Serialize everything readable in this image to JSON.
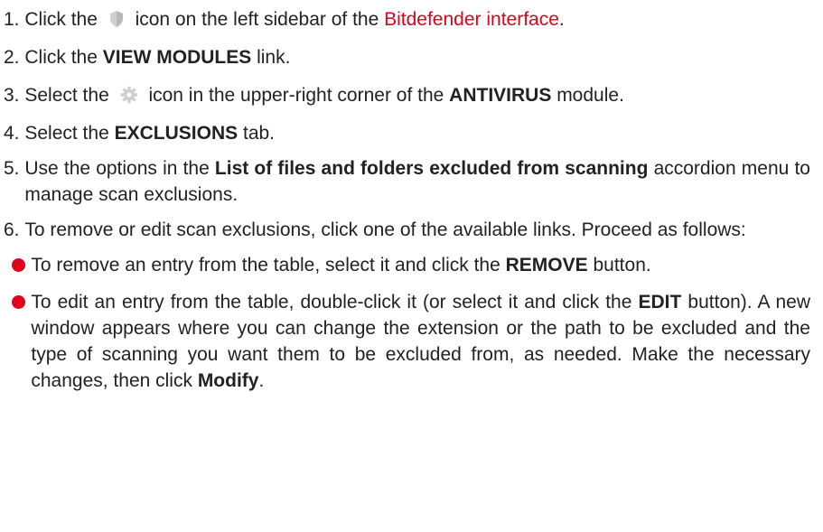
{
  "steps": [
    {
      "num": "1.",
      "pre": "Click the",
      "post": "icon on the left sidebar of the",
      "link": "Bitdefender interface",
      "end": "."
    },
    {
      "num": "2.",
      "pre": "Click the",
      "bold": "VIEW MODULES",
      "post": "link."
    },
    {
      "num": "3.",
      "pre": "Select the",
      "mid": "icon in the upper-right corner of the",
      "bold": "ANTIVIRUS",
      "post": "module."
    },
    {
      "num": "4.",
      "pre": "Select the",
      "bold": "EXCLUSIONS",
      "post": "tab."
    },
    {
      "num": "5.",
      "pre": "Use the options in the",
      "bold": "List of files and folders excluded from scanning",
      "post": "accordion menu to manage scan exclusions."
    },
    {
      "num": "6.",
      "text": "To remove or edit scan exclusions, click one of the available links. Proceed as follows:"
    }
  ],
  "bullets": [
    {
      "pre": "To remove an entry from the table, select it and click the",
      "bold": "REMOVE",
      "post": "button."
    },
    {
      "pre": "To edit an entry from the table, double-click it (or select it and click the",
      "bold": "EDIT",
      "mid": "button). A new window appears where you can change the extension or the path to be excluded and the type of scanning you want them to be excluded from, as needed. Make the necessary changes, then click",
      "bold2": "Modify",
      "end": "."
    }
  ],
  "icons": {
    "step1": "shield-icon",
    "step3": "gear-icon"
  },
  "colors": {
    "accent": "#e2001a",
    "text": "#222222",
    "icon": "#c9c9c9"
  }
}
